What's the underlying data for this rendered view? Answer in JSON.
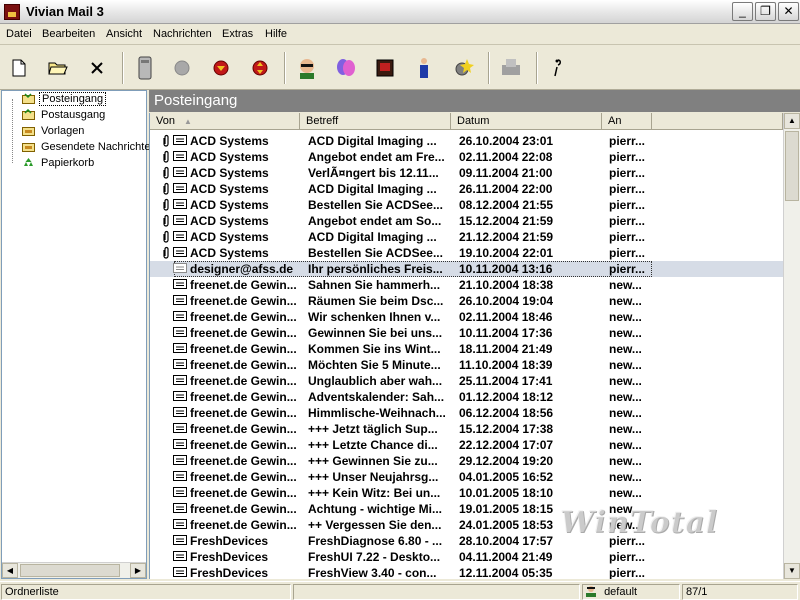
{
  "window": {
    "title": "Vivian Mail 3",
    "min_glyph": "_",
    "max_glyph": "❐",
    "close_glyph": "✕"
  },
  "menu": [
    "Datei",
    "Bearbeiten",
    "Ansicht",
    "Nachrichten",
    "Extras",
    "Hilfe"
  ],
  "toolbar": {
    "buttons": [
      {
        "name": "new-document-icon"
      },
      {
        "name": "open-folder-icon"
      },
      {
        "name": "delete-x-icon"
      },
      {
        "name": "trash-bin-icon"
      },
      {
        "name": "gray-circle-icon"
      },
      {
        "name": "red-down-arrow-icon"
      },
      {
        "name": "red-updown-arrow-icon"
      },
      {
        "name": "person-sunglasses-icon"
      },
      {
        "name": "masks-icon"
      },
      {
        "name": "book-icon"
      },
      {
        "name": "person-icon"
      },
      {
        "name": "gear-star-icon"
      },
      {
        "name": "fax-machine-icon"
      },
      {
        "name": "help-info-icon"
      }
    ]
  },
  "folders": [
    {
      "label": "Posteingang",
      "selected": true
    },
    {
      "label": "Postausgang",
      "selected": false
    },
    {
      "label": "Vorlagen",
      "selected": false
    },
    {
      "label": "Gesendete Nachrichten",
      "selected": false
    },
    {
      "label": "Papierkorb",
      "selected": false
    }
  ],
  "folder_header": "Posteingang",
  "columns": {
    "from": "Von",
    "subject": "Betreff",
    "date": "Datum",
    "to": "An",
    "sort_glyph": "▲"
  },
  "messages": [
    {
      "attach": true,
      "from": "ACD Systems",
      "subject": "ACD Digital Imaging ...",
      "date": "26.10.2004 23:01",
      "to": "pierr..."
    },
    {
      "attach": true,
      "from": "ACD Systems",
      "subject": "Angebot endet am Fre...",
      "date": "02.11.2004 22:08",
      "to": "pierr..."
    },
    {
      "attach": true,
      "from": "ACD Systems",
      "subject": "VerlÃ¤ngert bis 12.11...",
      "date": "09.11.2004 21:00",
      "to": "pierr..."
    },
    {
      "attach": true,
      "from": "ACD Systems",
      "subject": "ACD Digital Imaging ...",
      "date": "26.11.2004 22:00",
      "to": "pierr..."
    },
    {
      "attach": true,
      "from": "ACD Systems",
      "subject": "Bestellen Sie ACDSee...",
      "date": "08.12.2004 21:55",
      "to": "pierr..."
    },
    {
      "attach": true,
      "from": "ACD Systems",
      "subject": "Angebot endet am So...",
      "date": "15.12.2004 21:59",
      "to": "pierr..."
    },
    {
      "attach": true,
      "from": "ACD Systems",
      "subject": "ACD Digital Imaging ...",
      "date": "21.12.2004 21:59",
      "to": "pierr..."
    },
    {
      "attach": true,
      "from": "ACD Systems",
      "subject": "Bestellen Sie ACDSee...",
      "date": "19.10.2004 22:01",
      "to": "pierr..."
    },
    {
      "attach": false,
      "selected": true,
      "from": "designer@afss.de",
      "subject": "Ihr persönliches Freis...",
      "date": "10.11.2004 13:16",
      "to": "pierr..."
    },
    {
      "attach": false,
      "from": "freenet.de Gewin...",
      "subject": "Sahnen Sie hammerh...",
      "date": "21.10.2004 18:38",
      "to": "new..."
    },
    {
      "attach": false,
      "from": "freenet.de Gewin...",
      "subject": "Räumen Sie beim Dsc...",
      "date": "26.10.2004 19:04",
      "to": "new..."
    },
    {
      "attach": false,
      "from": "freenet.de Gewin...",
      "subject": "Wir schenken Ihnen v...",
      "date": "02.11.2004 18:46",
      "to": "new..."
    },
    {
      "attach": false,
      "from": "freenet.de Gewin...",
      "subject": "Gewinnen Sie bei uns...",
      "date": "10.11.2004 17:36",
      "to": "new..."
    },
    {
      "attach": false,
      "from": "freenet.de Gewin...",
      "subject": "Kommen Sie ins Wint...",
      "date": "18.11.2004 21:49",
      "to": "new..."
    },
    {
      "attach": false,
      "from": "freenet.de Gewin...",
      "subject": "Möchten Sie 5 Minute...",
      "date": "11.10.2004 18:39",
      "to": "new..."
    },
    {
      "attach": false,
      "from": "freenet.de Gewin...",
      "subject": "Unglaublich aber wah...",
      "date": "25.11.2004 17:41",
      "to": "new..."
    },
    {
      "attach": false,
      "from": "freenet.de Gewin...",
      "subject": "Adventskalender: Sah...",
      "date": "01.12.2004 18:12",
      "to": "new..."
    },
    {
      "attach": false,
      "from": "freenet.de Gewin...",
      "subject": "Himmlische-Weihnach...",
      "date": "06.12.2004 18:56",
      "to": "new..."
    },
    {
      "attach": false,
      "from": "freenet.de Gewin...",
      "subject": "+++ Jetzt täglich Sup...",
      "date": "15.12.2004 17:38",
      "to": "new..."
    },
    {
      "attach": false,
      "from": "freenet.de Gewin...",
      "subject": "+++ Letzte Chance di...",
      "date": "22.12.2004 17:07",
      "to": "new..."
    },
    {
      "attach": false,
      "from": "freenet.de Gewin...",
      "subject": "+++ Gewinnen Sie zu...",
      "date": "29.12.2004 19:20",
      "to": "new..."
    },
    {
      "attach": false,
      "from": "freenet.de Gewin...",
      "subject": "+++ Unser Neujahrsg...",
      "date": "04.01.2005 16:52",
      "to": "new..."
    },
    {
      "attach": false,
      "from": "freenet.de Gewin...",
      "subject": "+++ Kein Witz: Bei un...",
      "date": "10.01.2005 18:10",
      "to": "new..."
    },
    {
      "attach": false,
      "from": "freenet.de Gewin...",
      "subject": "Achtung - wichtige Mi...",
      "date": "19.01.2005 18:15",
      "to": "new..."
    },
    {
      "attach": false,
      "from": "freenet.de Gewin...",
      "subject": "++ Vergessen Sie den...",
      "date": "24.01.2005 18:53",
      "to": "new..."
    },
    {
      "attach": false,
      "from": "FreshDevices",
      "subject": "FreshDiagnose 6.80 - ...",
      "date": "28.10.2004 17:57",
      "to": "pierr..."
    },
    {
      "attach": false,
      "from": "FreshDevices",
      "subject": "FreshUI 7.22 - Deskto...",
      "date": "04.11.2004 21:49",
      "to": "pierr..."
    },
    {
      "attach": false,
      "from": "FreshDevices",
      "subject": "FreshView 3.40 - con...",
      "date": "12.11.2004 05:35",
      "to": "pierr..."
    }
  ],
  "watermark": "WinTotal",
  "status": {
    "left": "Ordnerliste",
    "profile": "default",
    "count": "87/1"
  },
  "scroll": {
    "left_arrow": "◀",
    "right_arrow": "▶",
    "up_arrow": "▲",
    "down_arrow": "▼"
  }
}
